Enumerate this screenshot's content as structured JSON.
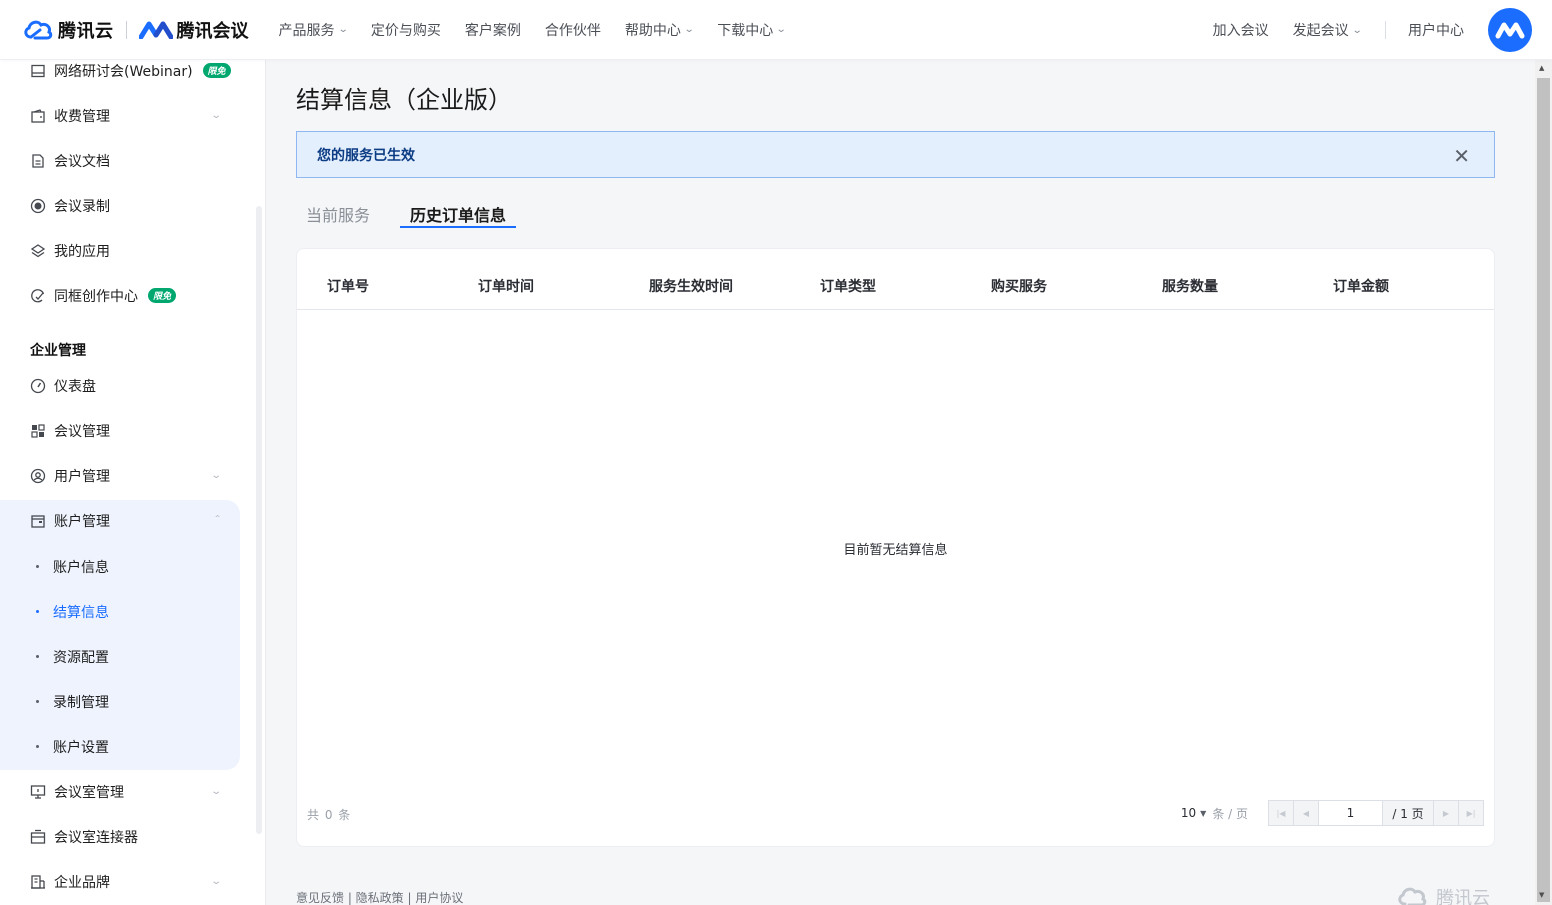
{
  "header": {
    "brand1": "腾讯云",
    "brand2": "腾讯会议",
    "nav": [
      {
        "label": "产品服务",
        "dropdown": true
      },
      {
        "label": "定价与购买",
        "dropdown": false
      },
      {
        "label": "客户案例",
        "dropdown": false
      },
      {
        "label": "合作伙伴",
        "dropdown": false
      },
      {
        "label": "帮助中心",
        "dropdown": true
      },
      {
        "label": "下载中心",
        "dropdown": true
      }
    ],
    "right": {
      "join": "加入会议",
      "start": "发起会议",
      "user_center": "用户中心"
    }
  },
  "sidebar": {
    "items_top": [
      {
        "label": "网络研讨会(Webinar)",
        "badge": "限免",
        "icon": "webinar-icon"
      },
      {
        "label": "收费管理",
        "icon": "wallet-icon",
        "arrow": "down"
      },
      {
        "label": "会议文档",
        "icon": "document-icon"
      },
      {
        "label": "会议录制",
        "icon": "record-icon"
      },
      {
        "label": "我的应用",
        "icon": "layers-icon"
      },
      {
        "label": "同框创作中心",
        "badge": "限免",
        "icon": "creation-icon"
      }
    ],
    "group_title": "企业管理",
    "items_enterprise": [
      {
        "label": "仪表盘",
        "icon": "dashboard-icon"
      },
      {
        "label": "会议管理",
        "icon": "grid-icon"
      },
      {
        "label": "用户管理",
        "icon": "user-icon",
        "arrow": "down"
      },
      {
        "label": "账户管理",
        "icon": "account-icon",
        "arrow": "up"
      }
    ],
    "account_sub": [
      {
        "label": "账户信息",
        "active": false
      },
      {
        "label": "结算信息",
        "active": true
      },
      {
        "label": "资源配置",
        "active": false
      },
      {
        "label": "录制管理",
        "active": false
      },
      {
        "label": "账户设置",
        "active": false
      }
    ],
    "items_bottom": [
      {
        "label": "会议室管理",
        "icon": "room-icon",
        "arrow": "down"
      },
      {
        "label": "会议室连接器",
        "icon": "connector-icon"
      },
      {
        "label": "企业品牌",
        "icon": "brand-icon",
        "arrow": "down"
      }
    ]
  },
  "main": {
    "title": "结算信息（企业版）",
    "alert": "您的服务已生效",
    "tabs": [
      {
        "label": "当前服务",
        "active": false
      },
      {
        "label": "历史订单信息",
        "active": true
      }
    ],
    "table": {
      "columns": [
        "订单号",
        "订单时间",
        "服务生效时间",
        "订单类型",
        "购买服务",
        "服务数量",
        "订单金额"
      ],
      "empty_text": "目前暂无结算信息"
    },
    "pagination": {
      "total_text": "共 0 条",
      "page_size": "10",
      "per_page_label": "条 / 页",
      "current_page": "1",
      "total_pages": "/ 1 页"
    }
  },
  "footer": {
    "links": "意见反馈 | 隐私政策 | 用户协议",
    "logo": "腾讯云"
  },
  "colors": {
    "accent": "#1a6dff",
    "badge": "#00a870",
    "alert_bg": "#e3effd",
    "alert_border": "#8fb8f3"
  }
}
